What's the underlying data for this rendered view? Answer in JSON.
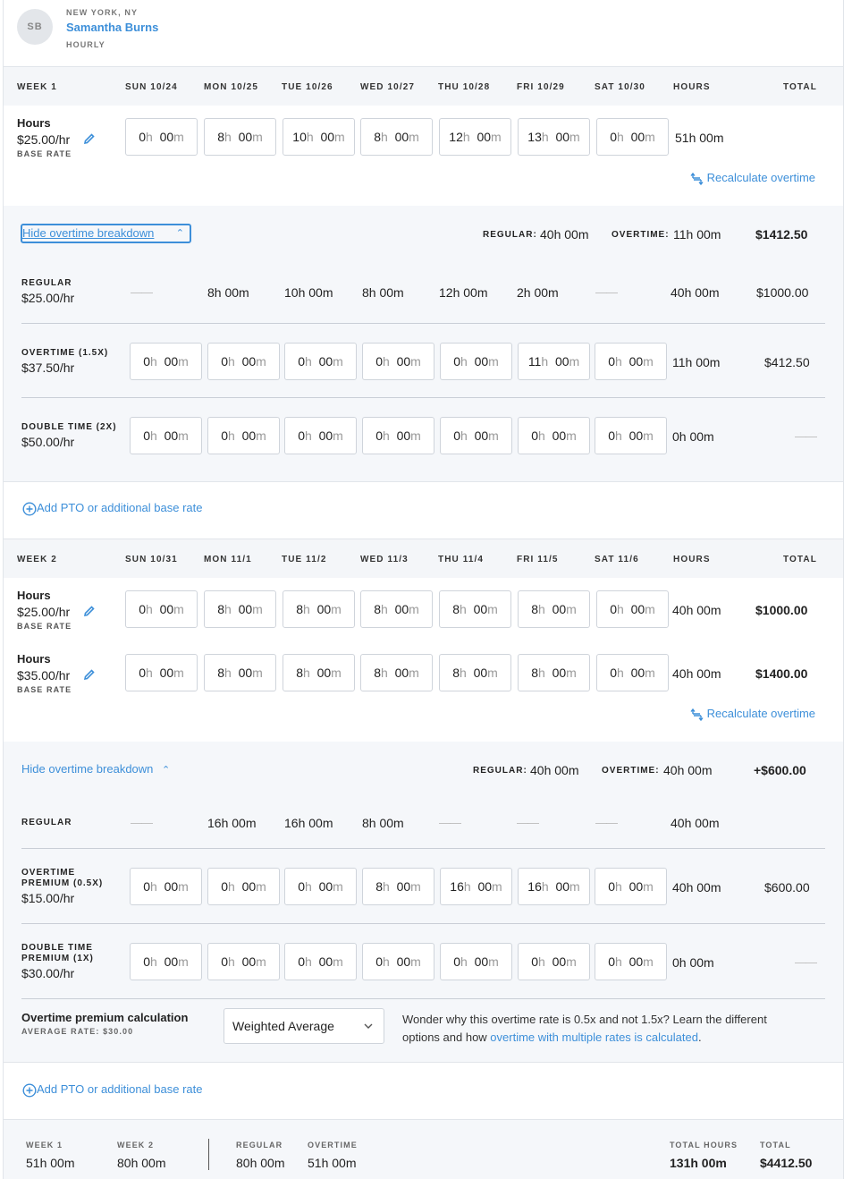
{
  "employee": {
    "initials": "SB",
    "location": "NEW YORK, NY",
    "name": "Samantha Burns",
    "pay_type": "HOURLY"
  },
  "units": {
    "h": "h",
    "m": "m"
  },
  "weeks": [
    {
      "header": [
        "WEEK 1",
        "SUN 10/24",
        "MON 10/25",
        "TUE 10/26",
        "WED 10/27",
        "THU 10/28",
        "FRI 10/29",
        "SAT 10/30",
        "HOURS",
        "TOTAL"
      ],
      "hours_rows": [
        {
          "label": "Hours",
          "rate": "$25.00/hr",
          "rate_caption": "BASE RATE",
          "days": [
            [
              "0",
              "00"
            ],
            [
              "8",
              "00"
            ],
            [
              "10",
              "00"
            ],
            [
              "8",
              "00"
            ],
            [
              "12",
              "00"
            ],
            [
              "13",
              "00"
            ],
            [
              "0",
              "00"
            ]
          ],
          "hours": "51h 00m",
          "total": ""
        }
      ],
      "recalculate": "Recalculate overtime",
      "breakdown": {
        "toggle": "Hide overtime breakdown",
        "regular_label": "REGULAR:",
        "regular": "40h 00m",
        "overtime_label": "OVERTIME:",
        "overtime": "11h 00m",
        "total": "$1412.50",
        "regular_row": {
          "label": "REGULAR",
          "rate": "$25.00/hr",
          "days": [
            "——",
            "8h 00m",
            "10h 00m",
            "8h 00m",
            "12h 00m",
            "2h 00m",
            "——"
          ],
          "hours": "40h 00m",
          "total": "$1000.00"
        },
        "overtime_row": {
          "label": "OVERTIME (1.5X)",
          "rate": "$37.50/hr",
          "days": [
            [
              "0",
              "00"
            ],
            [
              "0",
              "00"
            ],
            [
              "0",
              "00"
            ],
            [
              "0",
              "00"
            ],
            [
              "0",
              "00"
            ],
            [
              "11",
              "00"
            ],
            [
              "0",
              "00"
            ]
          ],
          "hours": "11h 00m",
          "total": "$412.50"
        },
        "double_row": {
          "label": "DOUBLE TIME (2X)",
          "rate": "$50.00/hr",
          "days": [
            [
              "0",
              "00"
            ],
            [
              "0",
              "00"
            ],
            [
              "0",
              "00"
            ],
            [
              "0",
              "00"
            ],
            [
              "0",
              "00"
            ],
            [
              "0",
              "00"
            ],
            [
              "0",
              "00"
            ]
          ],
          "hours": "0h 00m",
          "total": "——"
        }
      },
      "add_pto": "Add PTO or additional base rate"
    },
    {
      "header": [
        "WEEK 2",
        "SUN 10/31",
        "MON 11/1",
        "TUE 11/2",
        "WED 11/3",
        "THU 11/4",
        "FRI 11/5",
        "SAT 11/6",
        "HOURS",
        "TOTAL"
      ],
      "hours_rows": [
        {
          "label": "Hours",
          "rate": "$25.00/hr",
          "rate_caption": "BASE RATE",
          "days": [
            [
              "0",
              "00"
            ],
            [
              "8",
              "00"
            ],
            [
              "8",
              "00"
            ],
            [
              "8",
              "00"
            ],
            [
              "8",
              "00"
            ],
            [
              "8",
              "00"
            ],
            [
              "0",
              "00"
            ]
          ],
          "hours": "40h 00m",
          "total": "$1000.00"
        },
        {
          "label": "Hours",
          "rate": "$35.00/hr",
          "rate_caption": "BASE RATE",
          "days": [
            [
              "0",
              "00"
            ],
            [
              "8",
              "00"
            ],
            [
              "8",
              "00"
            ],
            [
              "8",
              "00"
            ],
            [
              "8",
              "00"
            ],
            [
              "8",
              "00"
            ],
            [
              "0",
              "00"
            ]
          ],
          "hours": "40h 00m",
          "total": "$1400.00"
        }
      ],
      "recalculate": "Recalculate overtime",
      "breakdown": {
        "toggle": "Hide overtime breakdown",
        "regular_label": "REGULAR:",
        "regular": "40h 00m",
        "overtime_label": "OVERTIME:",
        "overtime": "40h 00m",
        "total": "+$600.00",
        "regular_row": {
          "label": "REGULAR",
          "days": [
            "——",
            "16h 00m",
            "16h 00m",
            "8h 00m",
            "——",
            "——",
            "——"
          ],
          "hours": "40h 00m"
        },
        "overtime_row": {
          "label1": "OVERTIME",
          "label2": "PREMIUM (0.5X)",
          "rate": "$15.00/hr",
          "days": [
            [
              "0",
              "00"
            ],
            [
              "0",
              "00"
            ],
            [
              "0",
              "00"
            ],
            [
              "8",
              "00"
            ],
            [
              "16",
              "00"
            ],
            [
              "16",
              "00"
            ],
            [
              "0",
              "00"
            ]
          ],
          "hours": "40h 00m",
          "total": "$600.00"
        },
        "double_row": {
          "label1": "DOUBLE TIME",
          "label2": "PREMIUM (1X)",
          "rate": "$30.00/hr",
          "days": [
            [
              "0",
              "00"
            ],
            [
              "0",
              "00"
            ],
            [
              "0",
              "00"
            ],
            [
              "0",
              "00"
            ],
            [
              "0",
              "00"
            ],
            [
              "0",
              "00"
            ],
            [
              "0",
              "00"
            ]
          ],
          "hours": "0h 00m",
          "total": "——"
        },
        "premium": {
          "title": "Overtime premium calculation",
          "avg": "AVERAGE RATE: $30.00",
          "select": "Weighted Average",
          "text1": "Wonder why this overtime rate is 0.5x and not 1.5x? Learn the different",
          "text2": "options and how ",
          "link": "overtime with multiple rates is calculated",
          "text3": "."
        }
      },
      "add_pto": "Add PTO or additional base rate"
    }
  ],
  "summary": {
    "week1_label": "WEEK 1",
    "week1": "51h 00m",
    "week2_label": "WEEK 2",
    "week2": "80h 00m",
    "regular_label": "REGULAR",
    "regular": "80h 00m",
    "overtime_label": "OVERTIME",
    "overtime": "51h 00m",
    "total_hours_label": "TOTAL HOURS",
    "total_hours": "131h 00m",
    "total_label": "TOTAL",
    "total": "$4412.50"
  },
  "colors": {
    "link": "#3d8fd9",
    "band": "#f5f7fa"
  }
}
